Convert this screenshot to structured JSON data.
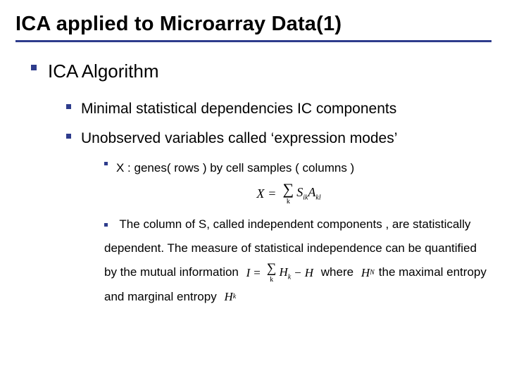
{
  "title": "ICA applied to Microarray Data(1)",
  "l1": {
    "text": "ICA Algorithm"
  },
  "l2a": {
    "text": "Minimal statistical dependencies IC components"
  },
  "l2b": {
    "text": "Unobserved variables called ‘expression modes’"
  },
  "l3a": {
    "text": "X : genes( rows ) by cell samples ( columns )"
  },
  "formula1": {
    "lhs": "X",
    "eq": "=",
    "sum_sub": "k",
    "term_base": "S",
    "term_sub1": "ik",
    "term2_base": "A",
    "term2_sub": "kl"
  },
  "l3b": {
    "part1": "The column of S, called independent components , are statistically dependent. The measure of statistical independence can be quantified by the mutual information",
    "where": "where",
    "tail1": "the maximal entropy",
    "tail2": "and marginal entropy"
  },
  "formula2": {
    "lhs": "I",
    "eq": "=",
    "sum_sub": "k",
    "t1_base": "H",
    "t1_sub": "k",
    "minus": "−",
    "t2_base": "H"
  },
  "sym": {
    "HN_base": "H",
    "HN_sub": "N",
    "Hk_base": "H",
    "Hk_sub": "k"
  }
}
